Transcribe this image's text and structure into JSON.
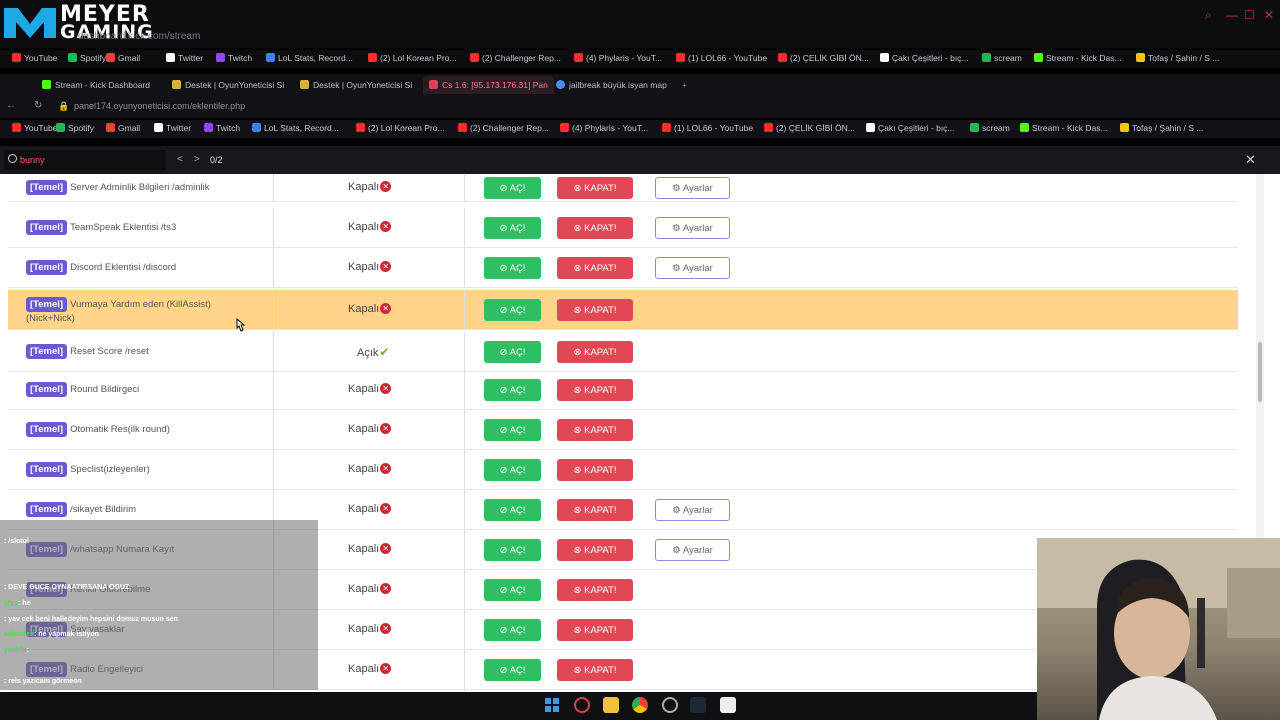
{
  "outer_browser": {
    "logo_line1": "MEYER",
    "logo_line2": "GAMING",
    "url": "dashboard.kick.com/stream",
    "bookmarks": [
      "YouTube",
      "Spotify",
      "Gmail",
      "Twitter",
      "Twitch",
      "LoL Stats, Record...",
      "(2) Lol Korean Pro...",
      "(2) Challenger Rep...",
      "(4) Phylaris - YouT...",
      "(1) LOL66 - YouTube",
      "(2) ÇELİK GİBİ ÖN...",
      "Çakı Çeşitleri - bıç...",
      "scream",
      "Stream - Kick Das...",
      "Tofaş / Şahin / S ..."
    ]
  },
  "inner_browser": {
    "tabs": [
      "Stream - Kick Dashboard",
      "Destek | OyunYoneticisi Si",
      "Destek | OyunYoneticisi Si",
      "Cs 1.6: [95.173.176.31] Pan",
      "jailbreak büyük isyan map"
    ],
    "url": "panel174.oyunyoneticisi.com/eklentiler.php",
    "bookmarks": [
      "YouTube",
      "Spotify",
      "Gmail",
      "Twitter",
      "Twitch",
      "LoL Stats, Record...",
      "(2) Lol Korean Pro...",
      "(2) Challenger Rep...",
      "(4) Phylaris - YouT...",
      "(1) LOL66 - YouTube",
      "(2) ÇELİK GİBİ ÖN...",
      "Çakı Çeşitleri - bıç...",
      "scream",
      "Stream - Kick Das...",
      "Tofaş / Şahin / S ..."
    ]
  },
  "find": {
    "query": "bunny",
    "count": "0/2"
  },
  "labels": {
    "badge": "[Temel]",
    "on": "AÇ!",
    "off": "KAPAT!",
    "settings": "Ayarlar",
    "closed": "Kapalı",
    "open": "Açık"
  },
  "plugins": [
    {
      "name": "Server Adminlik Bilgileri /adminlik",
      "status": "Kapalı",
      "settings": true
    },
    {
      "name": "TeamSpeak Eklentisi /ts3",
      "status": "Kapalı",
      "settings": true
    },
    {
      "name": "Discord Eklentisi /discord",
      "status": "Kapalı",
      "settings": true
    },
    {
      "name": "Vurmaya Yardım eden (KillAssist) (Nick+Nick)",
      "status": "Kapalı",
      "settings": false,
      "highlighted": true
    },
    {
      "name": "Reset Score /reset",
      "status": "Açık",
      "settings": false
    },
    {
      "name": "Round Bildirgeci",
      "status": "Kapalı",
      "settings": false
    },
    {
      "name": "Otomatik Res(ilk round)",
      "status": "Kapalı",
      "settings": false
    },
    {
      "name": "Speclist(izleyenler)",
      "status": "Kapalı",
      "settings": false
    },
    {
      "name": "/sikayet Bildirim",
      "status": "Kapalı",
      "settings": true
    },
    {
      "name": "/whatsapp Numara Kayıt",
      "status": "Kapalı",
      "settings": true
    },
    {
      "name": "Renkli Öldürebilme",
      "status": "Kapalı",
      "settings": false
    },
    {
      "name": "Say yasaklar",
      "status": "Kapalı",
      "settings": false
    },
    {
      "name": "Radio Engelleyici",
      "status": "Kapalı",
      "settings": false
    }
  ],
  "chat": [
    {
      "user": "",
      "text": ": /slotol"
    },
    {
      "user": "",
      "text": ""
    },
    {
      "user": "",
      "text": ": DEVE GUCE OYNAATIRSANA OGUZ"
    },
    {
      "user": "lifys",
      "text": ": he"
    },
    {
      "user": "",
      "text": ": yav cek beni halledeyim hepsini domuz musun sen"
    },
    {
      "user": "vahsideli",
      "text": ": ne yapmak istiyon"
    },
    {
      "user": "yuchhi",
      "text": ":"
    },
    {
      "user": "",
      "text": ": reis yazıcam görmeon"
    },
    {
      "user": "ksakan",
      "text": ":"
    },
    {
      "user": "yuchhi",
      "text": ":"
    }
  ],
  "colors": {
    "badge": "#6a5acd",
    "on_button": "#2fbe63",
    "off_button": "#e04856",
    "highlight_row": "#fdd48a"
  }
}
